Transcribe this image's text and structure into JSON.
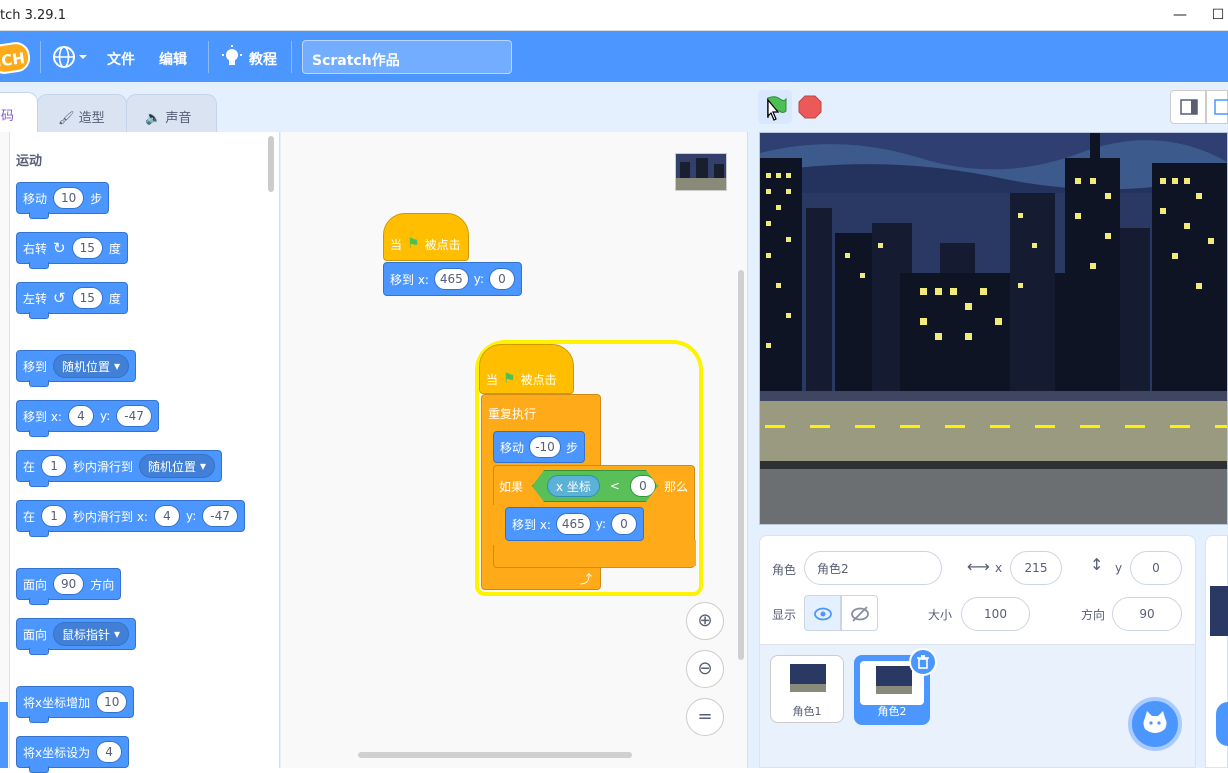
{
  "titlebar": {
    "title": "tch 3.29.1",
    "minimize": "—",
    "maximize": "☐"
  },
  "menubar": {
    "logo": "ICH",
    "file": "文件",
    "edit": "编辑",
    "tutorial": "教程",
    "project_title": "Scratch作品"
  },
  "tabs": {
    "code": "码",
    "costumes": "造型",
    "sounds": "声音"
  },
  "palette": {
    "category": "运动",
    "blocks": {
      "move": [
        "移动",
        "10",
        "步"
      ],
      "turn_right": [
        "右转",
        "15",
        "度"
      ],
      "turn_left": [
        "左转",
        "15",
        "度"
      ],
      "goto": [
        "移到",
        "随机位置"
      ],
      "goto_xy": [
        "移到 x:",
        "4",
        "y:",
        "-47"
      ],
      "glide": [
        "在",
        "1",
        "秒内滑行到",
        "随机位置"
      ],
      "glide_xy": [
        "在",
        "1",
        "秒内滑行到 x:",
        "4",
        "y:",
        "-47"
      ],
      "point_dir": [
        "面向",
        "90",
        "方向"
      ],
      "point_towards": [
        "面向",
        "鼠标指针"
      ],
      "change_x": [
        "将x坐标增加",
        "10"
      ],
      "set_x": [
        "将x坐标设为",
        "4"
      ]
    }
  },
  "script": {
    "s1_hat": [
      "当",
      "被点击"
    ],
    "s1_goto": [
      "移到 x:",
      "465",
      "y:",
      "0"
    ],
    "s2_hat": [
      "当",
      "被点击"
    ],
    "s2_forever": "重复执行",
    "s2_move": [
      "移动",
      "-10",
      "步"
    ],
    "s2_if": [
      "如果",
      "x 坐标",
      "<",
      "0",
      "那么"
    ],
    "s2_goto": [
      "移到 x:",
      "465",
      "y:",
      "0"
    ]
  },
  "sprite_info": {
    "sprite_label": "角色",
    "sprite_name": "角色2",
    "x_label": "x",
    "x_value": "215",
    "y_label": "y",
    "y_value": "0",
    "show_label": "显示",
    "size_label": "大小",
    "size_value": "100",
    "direction_label": "方向",
    "direction_value": "90"
  },
  "sprites": [
    {
      "name": "角色1",
      "selected": false
    },
    {
      "name": "角色2",
      "selected": true
    }
  ],
  "colors": {
    "motion": "#4c97ff",
    "events": "#ffbf00",
    "control": "#ffab19",
    "operators": "#59c059",
    "menubar": "#4c97ff"
  }
}
